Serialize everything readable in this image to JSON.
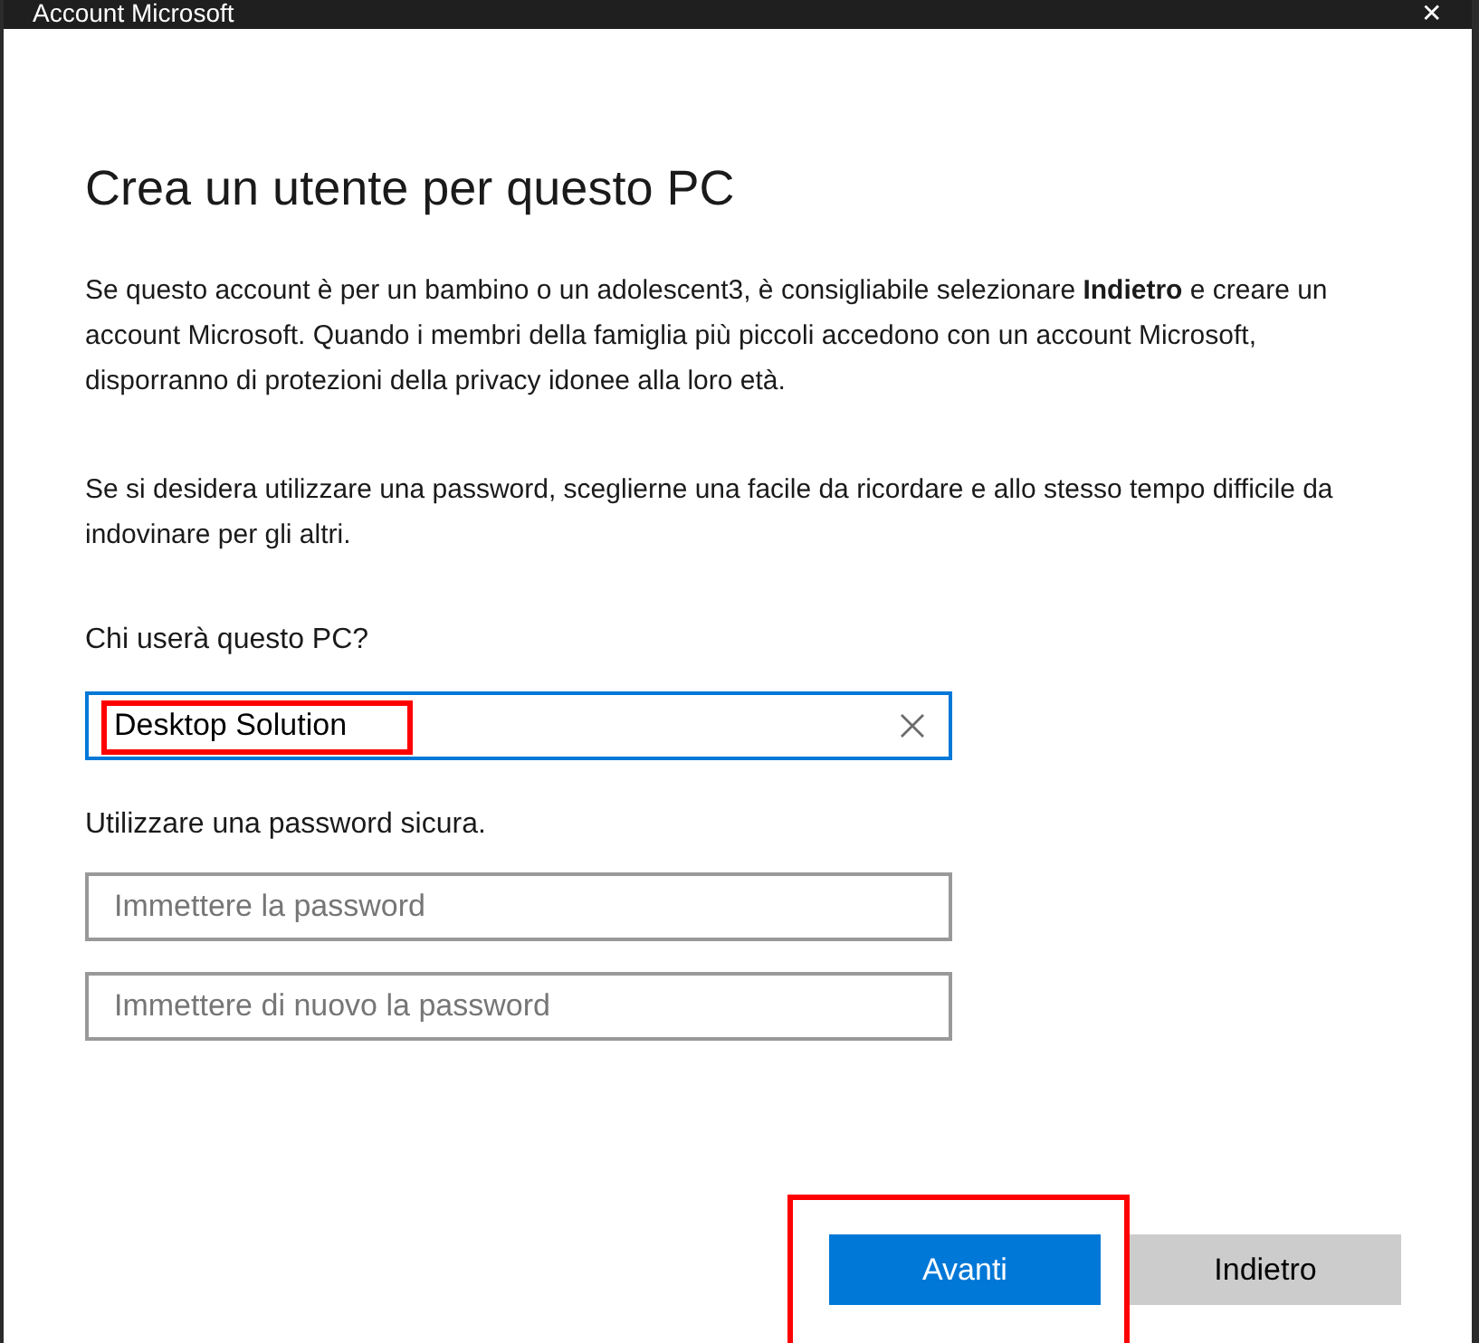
{
  "window": {
    "title": "Account Microsoft",
    "close": "✕"
  },
  "heading": "Crea un utente per questo PC",
  "paragraphs": [
    "Se questo account è per un bambino o un adolescent3, è consigliabile selezionare **Indietro** e creare un account Microsoft. Quando i membri della famiglia più piccoli accedono con un account Microsoft, disporranno di protezioni della privacy idonee alla loro età.",
    "Se si desidera utilizzare una password, sceglierne una facile da ricordare e allo stesso tempo difficile da indovinare per gli altri."
  ],
  "user_label": "Chi userà questo PC?",
  "user_field": {
    "value": "Desktop Solution",
    "focused": true,
    "highlighted": true
  },
  "password_label": "Utilizzare una password sicura.",
  "password_fields": [
    {
      "placeholder": "Immettere la password"
    },
    {
      "placeholder": "Immettere di nuovo la password"
    }
  ],
  "buttons": [
    {
      "label": "Avanti",
      "kind": "primary",
      "highlighted": true
    },
    {
      "label": "Indietro",
      "kind": "secondary",
      "highlighted": false
    }
  ]
}
